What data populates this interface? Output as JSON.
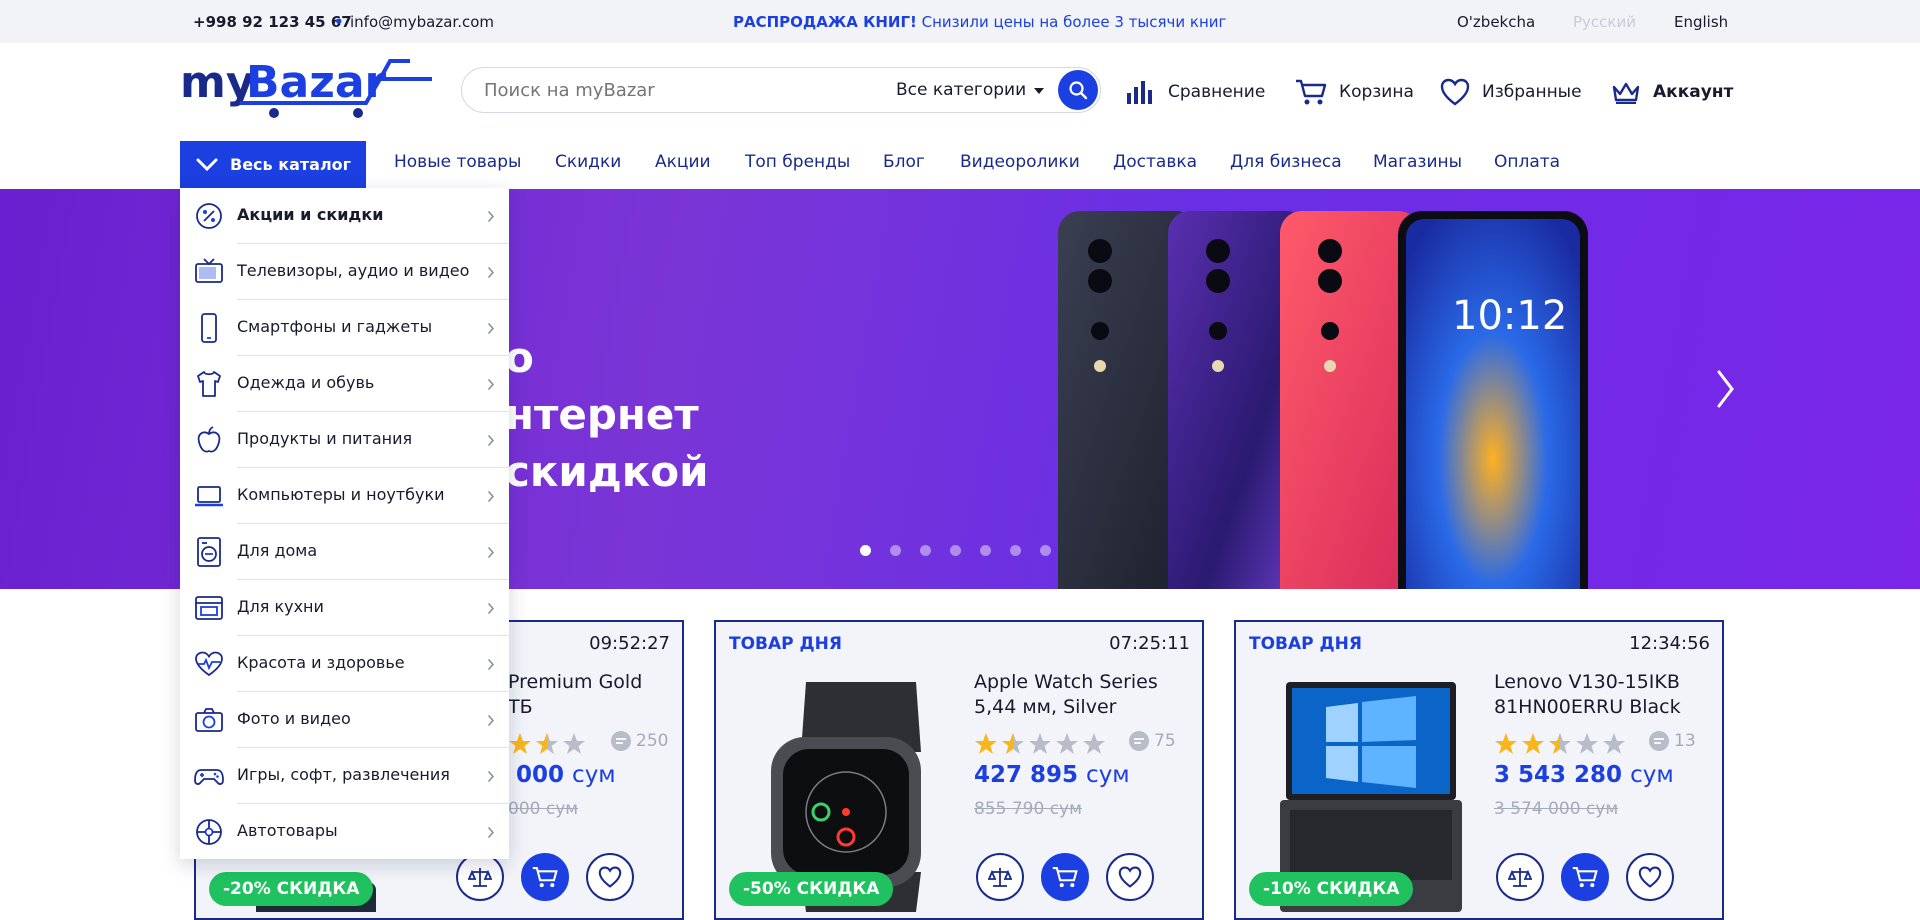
{
  "topbar": {
    "phone": "+998 92 123 45 67",
    "dot": "•",
    "email": "info@mybazar.com",
    "promo_bold": "РАСПРОДАЖА КНИГ!",
    "promo_text": "Снизили цены на более 3 тысячи книг",
    "languages": [
      "O'zbekcha",
      "Русский",
      "English"
    ]
  },
  "header": {
    "logo_text": "myBazar",
    "search_placeholder": "Поиск на myBazar",
    "search_category": "Все категории",
    "links": {
      "compare": "Сравнение",
      "cart": "Корзина",
      "favorites": "Избранные",
      "account": "Аккаунт"
    }
  },
  "nav": {
    "catalog_label": "Весь каталог",
    "items": [
      "Новые товары",
      "Скидки",
      "Акции",
      "Топ бренды",
      "Блог",
      "Видеоролики",
      "Доставка",
      "Для бизнеса",
      "Магазины",
      "Оплата"
    ]
  },
  "catalog": {
    "items": [
      {
        "label": "Акции и скидки",
        "icon": "percent-badge-icon"
      },
      {
        "label": "Телевизоры, аудио и видео",
        "icon": "tv-icon"
      },
      {
        "label": "Смартфоны и гаджеты",
        "icon": "smartphone-icon"
      },
      {
        "label": "Одежда и обувь",
        "icon": "tshirt-icon"
      },
      {
        "label": "Продукты и питания",
        "icon": "apple-icon"
      },
      {
        "label": "Компьютеры и ноутбуки",
        "icon": "laptop-icon"
      },
      {
        "label": "Для дома",
        "icon": "washing-machine-icon"
      },
      {
        "label": "Для кухни",
        "icon": "oven-icon"
      },
      {
        "label": "Красота и здоровье",
        "icon": "heart-pulse-icon"
      },
      {
        "label": "Фото и видео",
        "icon": "camera-icon"
      },
      {
        "label": "Игры, софт, развлечения",
        "icon": "gamepad-icon"
      },
      {
        "label": "Автотовары",
        "icon": "steering-wheel-icon"
      }
    ]
  },
  "banner": {
    "headline_lines": [
      "о",
      "нтернет",
      "скидкой"
    ],
    "slide_count": 7,
    "active_slide": 1
  },
  "deals": [
    {
      "label": "",
      "timer": "09:52:27",
      "name": "Premium Gold\nТБ",
      "rating": 3.5,
      "reviews": "250",
      "price": "0 000",
      "currency": "сум",
      "old_price": "000 сум",
      "discount": "-20% СКИДКА"
    },
    {
      "label": "ТОВАР ДНЯ",
      "timer": "07:25:11",
      "name": "Apple Watch Series\n5,44 мм, Silver",
      "rating": 1.5,
      "reviews": "75",
      "price": "427 895",
      "currency": "сум",
      "old_price": "855 790 сум",
      "discount": "-50% СКИДКА"
    },
    {
      "label": "ТОВАР ДНЯ",
      "timer": "12:34:56",
      "name": "Lenovo V130-15IKB\n81HN00ERRU Black",
      "rating": 2.5,
      "reviews": "13",
      "price": "3 543 280",
      "currency": "сум",
      "old_price": "3 574 000 сум",
      "discount": "-10% СКИДКА"
    }
  ],
  "colors": {
    "accent": "#1b3fe0",
    "navy": "#1a2a8a",
    "discount": "#1fc25f",
    "banner": "#6a1fd0",
    "star": "#f5b71c"
  }
}
